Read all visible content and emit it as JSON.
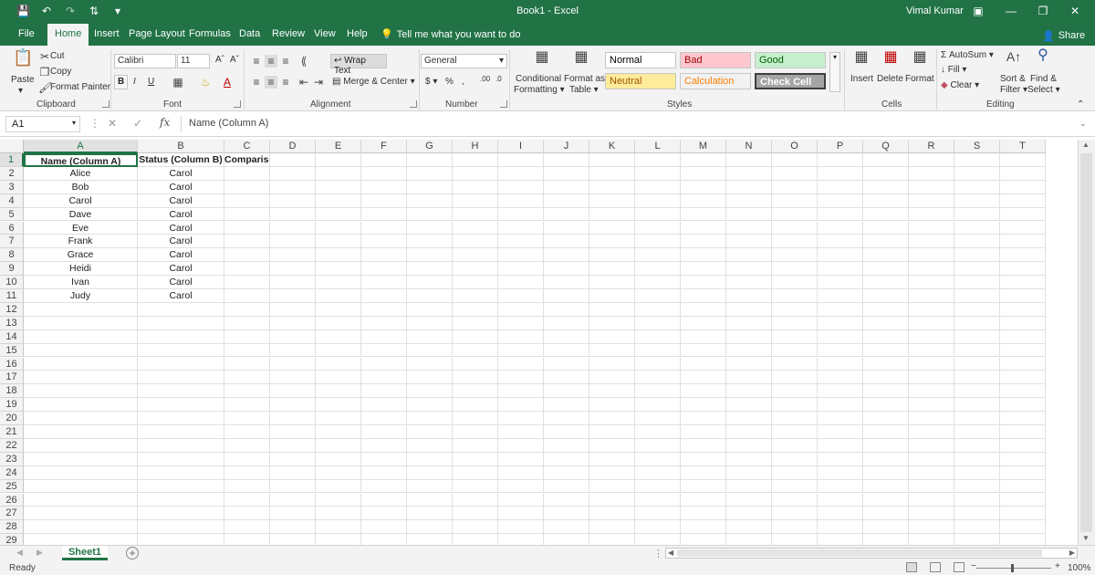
{
  "window": {
    "title": "Book1  -  Excel",
    "user": "Vimal Kumar"
  },
  "tabs": [
    "File",
    "Home",
    "Insert",
    "Page Layout",
    "Formulas",
    "Data",
    "Review",
    "View",
    "Help"
  ],
  "active_tab": "Home",
  "tell_me": "Tell me what you want to do",
  "share": "Share",
  "ribbon": {
    "clipboard": {
      "paste": "Paste",
      "cut": "Cut",
      "copy": "Copy",
      "format_painter": "Format Painter",
      "label": "Clipboard"
    },
    "font": {
      "name": "Calibri",
      "size": "11",
      "bold": "B",
      "italic": "I",
      "underline": "U",
      "label": "Font"
    },
    "alignment": {
      "wrap_text": "Wrap Text",
      "merge_center": "Merge & Center",
      "label": "Alignment"
    },
    "number": {
      "format": "General",
      "label": "Number"
    },
    "styles": {
      "conditional": "Conditional",
      "conditional2": "Formatting",
      "format_as": "Format as",
      "format_as2": "Table",
      "cells": [
        {
          "label": "Normal",
          "bg": "#ffffff",
          "color": "#000000"
        },
        {
          "label": "Bad",
          "bg": "#ffc7ce",
          "color": "#9c0006"
        },
        {
          "label": "Good",
          "bg": "#c6efce",
          "color": "#006100"
        },
        {
          "label": "Neutral",
          "bg": "#ffeb9c",
          "color": "#9c5700"
        },
        {
          "label": "Calculation",
          "bg": "#f2f2f2",
          "color": "#fa7d00"
        },
        {
          "label": "Check Cell",
          "bg": "#a5a5a5",
          "color": "#ffffff"
        }
      ],
      "label": "Styles"
    },
    "cells": {
      "insert": "Insert",
      "delete": "Delete",
      "format": "Format",
      "label": "Cells"
    },
    "editing": {
      "autosum": "AutoSum",
      "fill": "Fill",
      "clear": "Clear",
      "sort1": "Sort &",
      "sort2": "Filter",
      "find1": "Find &",
      "find2": "Select",
      "label": "Editing"
    }
  },
  "formula_bar": {
    "name_box": "A1",
    "fx": "fx",
    "content": "Name (Column A)"
  },
  "columns": [
    "A",
    "B",
    "C",
    "D",
    "E",
    "F",
    "G",
    "H",
    "I",
    "J",
    "K",
    "L",
    "M",
    "N",
    "O",
    "P",
    "Q",
    "R",
    "S",
    "T"
  ],
  "rows": [
    "1",
    "2",
    "3",
    "4",
    "5",
    "6",
    "7",
    "8",
    "9",
    "10",
    "11",
    "12",
    "13",
    "14",
    "15",
    "16",
    "17",
    "18",
    "19",
    "20",
    "21",
    "22",
    "23",
    "24",
    "25",
    "26",
    "27",
    "28",
    "29"
  ],
  "cells": {
    "A": [
      "Name (Column A)",
      "Alice",
      "Bob",
      "Carol",
      "Dave",
      "Eve",
      "Frank",
      "Grace",
      "Heidi",
      "Ivan",
      "Judy"
    ],
    "B": [
      "Status (Column B)",
      "Carol",
      "Carol",
      "Carol",
      "Carol",
      "Carol",
      "Carol",
      "Carol",
      "Carol",
      "Carol",
      "Carol"
    ],
    "C": [
      "Comparison"
    ]
  },
  "sheets": [
    "Sheet1"
  ],
  "status": {
    "ready": "Ready",
    "zoom": "100%"
  }
}
